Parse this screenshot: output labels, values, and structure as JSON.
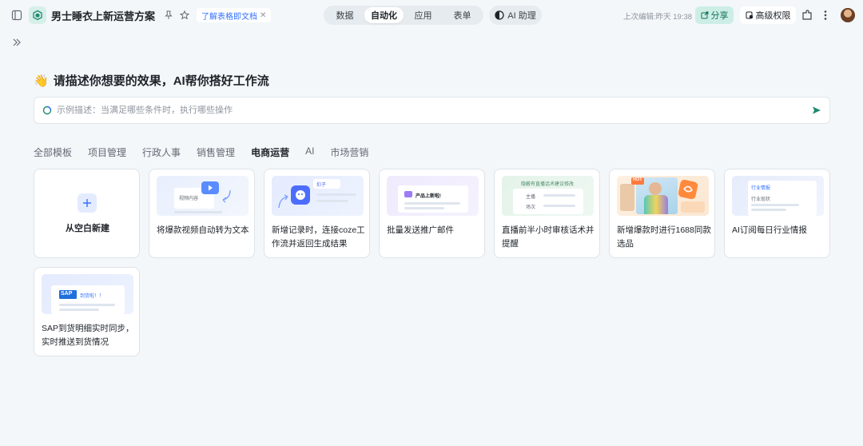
{
  "topbar": {
    "doc_title": "男士睡衣上新运营方案",
    "learn_chip": "了解表格即文档",
    "tabs": [
      "数据",
      "自动化",
      "应用",
      "表单"
    ],
    "active_tab": "自动化",
    "ai_assistant": "AI 助理",
    "last_edit": "上次编辑:昨天 19:38",
    "share": "分享",
    "advanced_permissions": "高级权限"
  },
  "main": {
    "wave": "👋",
    "heading": "请描述你想要的效果，AI帮你搭好工作流",
    "prompt_placeholder": "示例描述：当满足哪些条件时，执行哪些操作",
    "categories": [
      "全部模板",
      "项目管理",
      "行政人事",
      "销售管理",
      "电商运营",
      "AI",
      "市场营销"
    ],
    "active_category": "电商运营",
    "blank_card": "从空白新建",
    "templates": [
      {
        "label": "将爆款视频自动转为文本",
        "thumb_text": "视频内容"
      },
      {
        "label": "新增记录时，连接coze工作流并返回生成结果",
        "thumb_text": "扣子"
      },
      {
        "label": "批量发送推广邮件",
        "thumb_text": "产品上新啦!"
      },
      {
        "label": "直播前半小时审核话术并提醒",
        "thumb_text": "隐蔽有直播话术建议修改",
        "thumb_rows": [
          "主播",
          "场次"
        ]
      },
      {
        "label": "新增爆款时进行1688同款选品",
        "thumb_text": "HOT"
      },
      {
        "label": "AI订阅每日行业情报",
        "thumb_text": "行业情报",
        "thumb_sub": "行业现状"
      },
      {
        "label": "SAP到货明细实时同步，实时推送到货情况",
        "thumb_text": "到货啦！！",
        "thumb_logo": "SAP"
      }
    ]
  },
  "colors": {
    "accent_green": "#10705a",
    "accent_blue": "#3370ff",
    "background": "#f3f7fa"
  }
}
